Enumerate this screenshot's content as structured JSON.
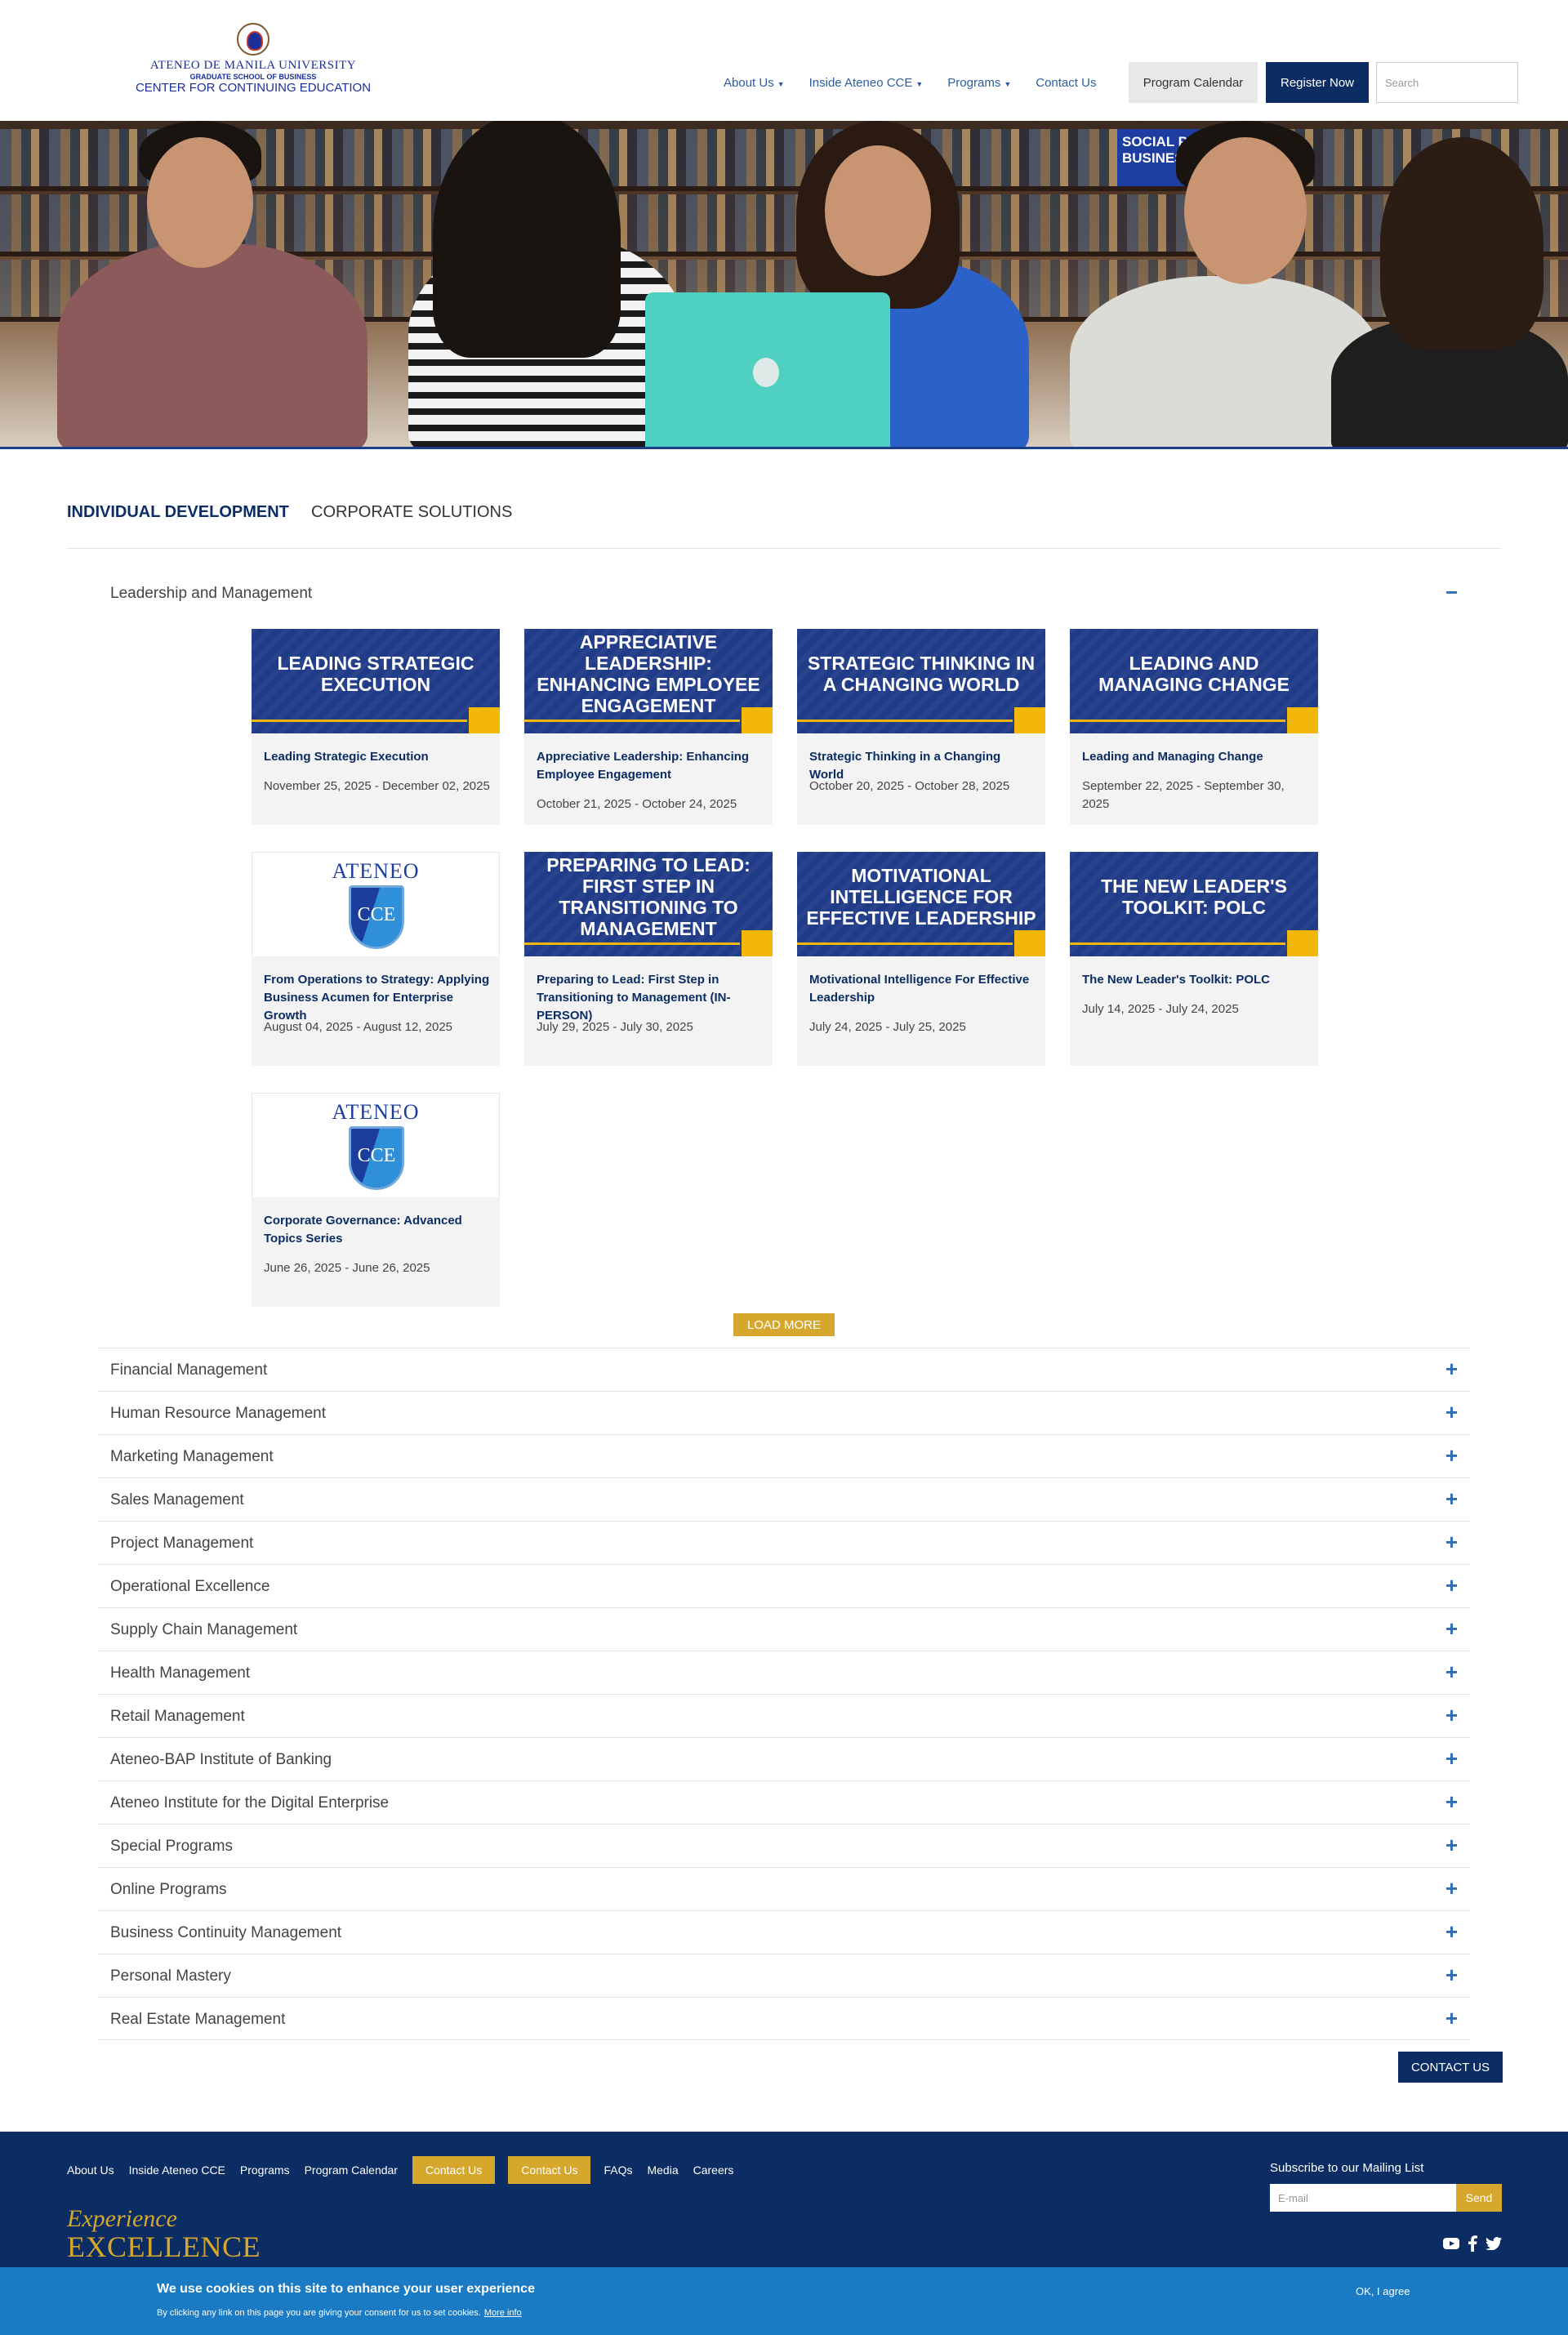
{
  "header": {
    "logo": {
      "line1": "ATENEO DE MANILA UNIVERSITY",
      "line2": "GRADUATE SCHOOL OF BUSINESS",
      "line3": "CENTER FOR CONTINUING EDUCATION"
    },
    "nav": [
      {
        "label": "About Us",
        "dropdown": true
      },
      {
        "label": "Inside Ateneo CCE",
        "dropdown": true
      },
      {
        "label": "Programs",
        "dropdown": true
      },
      {
        "label": "Contact Us",
        "dropdown": false
      }
    ],
    "program_calendar": "Program Calendar",
    "register_now": "Register Now",
    "search_placeholder": "Search"
  },
  "hero": {
    "sign_text": "SOCIAL PH AN BUSINES"
  },
  "tabs": [
    {
      "label": "INDIVIDUAL DEVELOPMENT",
      "active": true
    },
    {
      "label": "CORPORATE SOLUTIONS",
      "active": false
    }
  ],
  "open_category": {
    "title": "Leadership and Management",
    "toggle": "−",
    "cards": [
      {
        "banner": "Leading Strategic Execution",
        "title": "Leading Strategic Execution",
        "date": "November 25, 2025 - December 02, 2025",
        "image": "banner"
      },
      {
        "banner": "Appreciative Leadership: Enhancing Employee Engagement",
        "title": "Appreciative Leadership: Enhancing Employee Engagement",
        "date": "October 21, 2025 - October 24, 2025",
        "image": "banner"
      },
      {
        "banner": "Strategic Thinking in a Changing World",
        "title": "Strategic Thinking in a Changing World",
        "date": "October 20, 2025 - October 28, 2025",
        "image": "banner"
      },
      {
        "banner": "Leading and Managing Change",
        "title": "Leading and Managing Change",
        "date": "September 22, 2025 - September 30, 2025",
        "image": "banner"
      },
      {
        "banner": "",
        "title": "From Operations to Strategy: Applying Business Acumen for Enterprise Growth",
        "date": "August 04, 2025 - August 12, 2025",
        "image": "logo"
      },
      {
        "banner": "Preparing to Lead: First Step in Transitioning to Management",
        "title": "Preparing to Lead: First Step in Transitioning to Management (IN-PERSON)",
        "date": "July 29, 2025 - July 30, 2025",
        "image": "banner"
      },
      {
        "banner": "Motivational Intelligence for Effective Leadership",
        "title": "Motivational Intelligence For Effective Leadership",
        "date": "July 24, 2025 - July 25, 2025",
        "image": "banner"
      },
      {
        "banner": "The New Leader's Toolkit: POLC",
        "title": "The New Leader's Toolkit: POLC",
        "date": "July 14, 2025 - July 24, 2025",
        "image": "banner"
      },
      {
        "banner": "",
        "title": "Corporate Governance: Advanced Topics Series",
        "date": "June 26, 2025 - June 26, 2025",
        "image": "logo"
      }
    ],
    "logo_word": "ATENEO",
    "logo_mark": "CCE",
    "load_more": "LOAD MORE"
  },
  "categories": [
    "Financial Management",
    "Human Resource Management",
    "Marketing Management",
    "Sales Management",
    "Project Management",
    "Operational Excellence",
    "Supply Chain Management",
    "Health Management",
    "Retail Management",
    "Ateneo-BAP Institute of Banking",
    "Ateneo Institute for the Digital Enterprise",
    "Special Programs",
    "Online Programs",
    "Business Continuity Management",
    "Personal Mastery",
    "Real Estate Management"
  ],
  "plus": "+",
  "contact_button": "CONTACT US",
  "footer": {
    "links": [
      "About Us",
      "Inside Ateneo CCE",
      "Programs",
      "Program Calendar"
    ],
    "buttons": [
      "Contact Us",
      "Contact Us"
    ],
    "links2": [
      "FAQs",
      "Media",
      "Careers"
    ],
    "tagline1": "Experience",
    "tagline2": "EXCELLENCE",
    "subscribe_label": "Subscribe to our Mailing List",
    "email_placeholder": "E-mail",
    "send": "Send",
    "social": [
      "youtube-icon",
      "facebook-icon",
      "twitter-icon"
    ]
  },
  "cookie": {
    "title": "We use cookies on this site to enhance your user experience",
    "text": "By clicking any link on this page you are giving your consent for us to set cookies.",
    "more": "More info",
    "ok": "OK, I agree"
  },
  "colors": {
    "navy": "#0b2d63",
    "gold": "#d6a72d",
    "link_blue": "#2d5d9e",
    "cookie_blue": "#1a7bc4"
  }
}
